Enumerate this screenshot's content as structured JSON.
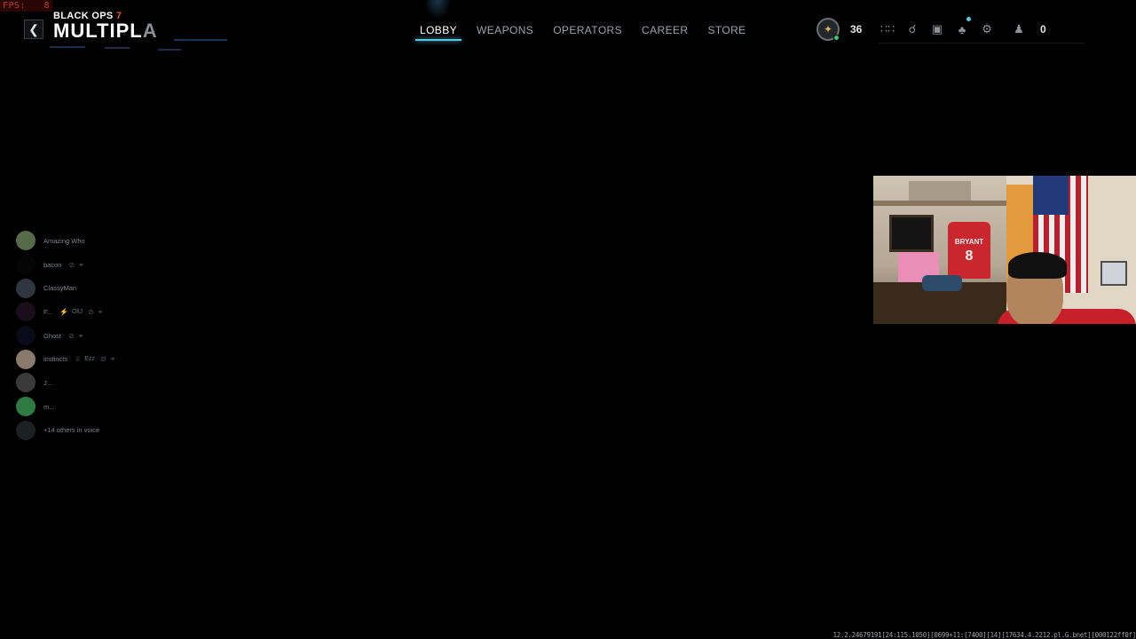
{
  "overlay": {
    "fps_label": "FPS:",
    "fps_value": "8"
  },
  "header": {
    "game_name": "BLACK OPS",
    "game_number": "7",
    "mode_visible": "MULTIPL",
    "mode_faded": "A"
  },
  "nav": {
    "tabs": [
      {
        "label": "LOBBY",
        "active": true
      },
      {
        "label": "WEAPONS",
        "active": false
      },
      {
        "label": "OPERATORS",
        "active": false
      },
      {
        "label": "CAREER",
        "active": false
      },
      {
        "label": "STORE",
        "active": false
      }
    ]
  },
  "hud": {
    "level": "36",
    "party_count": "0",
    "icons": [
      "grid-icon",
      "unlock-icon",
      "inbox-icon",
      "notification-bell-icon",
      "settings-gear-icon",
      "party-icon"
    ],
    "accent_color": "#5bc8e8"
  },
  "voice": {
    "members": [
      {
        "name": "Amazing Who",
        "tags": []
      },
      {
        "name": "bacon",
        "tags": [
          "mute-icon",
          "headset-off-icon"
        ]
      },
      {
        "name": "ClassyMan",
        "tags": []
      },
      {
        "name": "F...",
        "tags_text": "OllJ",
        "tags": [
          "mute-icon",
          "headset-off-icon"
        ]
      },
      {
        "name": "Ghost",
        "tags": [
          "mute-icon",
          "headset-off-icon"
        ]
      },
      {
        "name": "instincts",
        "tags_text": "Ezz",
        "tags": [
          "mute-icon",
          "headset-off-icon"
        ]
      },
      {
        "name": "J...",
        "tags": []
      },
      {
        "name": "m...",
        "tags": []
      },
      {
        "name": "+14 others in voice",
        "tags": []
      }
    ]
  },
  "webcam": {
    "jersey_name": "BRYANT",
    "jersey_number": "8"
  },
  "debug": {
    "build_info": "12.2.24679191[24:115.1050][0699+11:[7400][14][17634.4.2212.pl.G.bnet][000122ff0f]"
  }
}
